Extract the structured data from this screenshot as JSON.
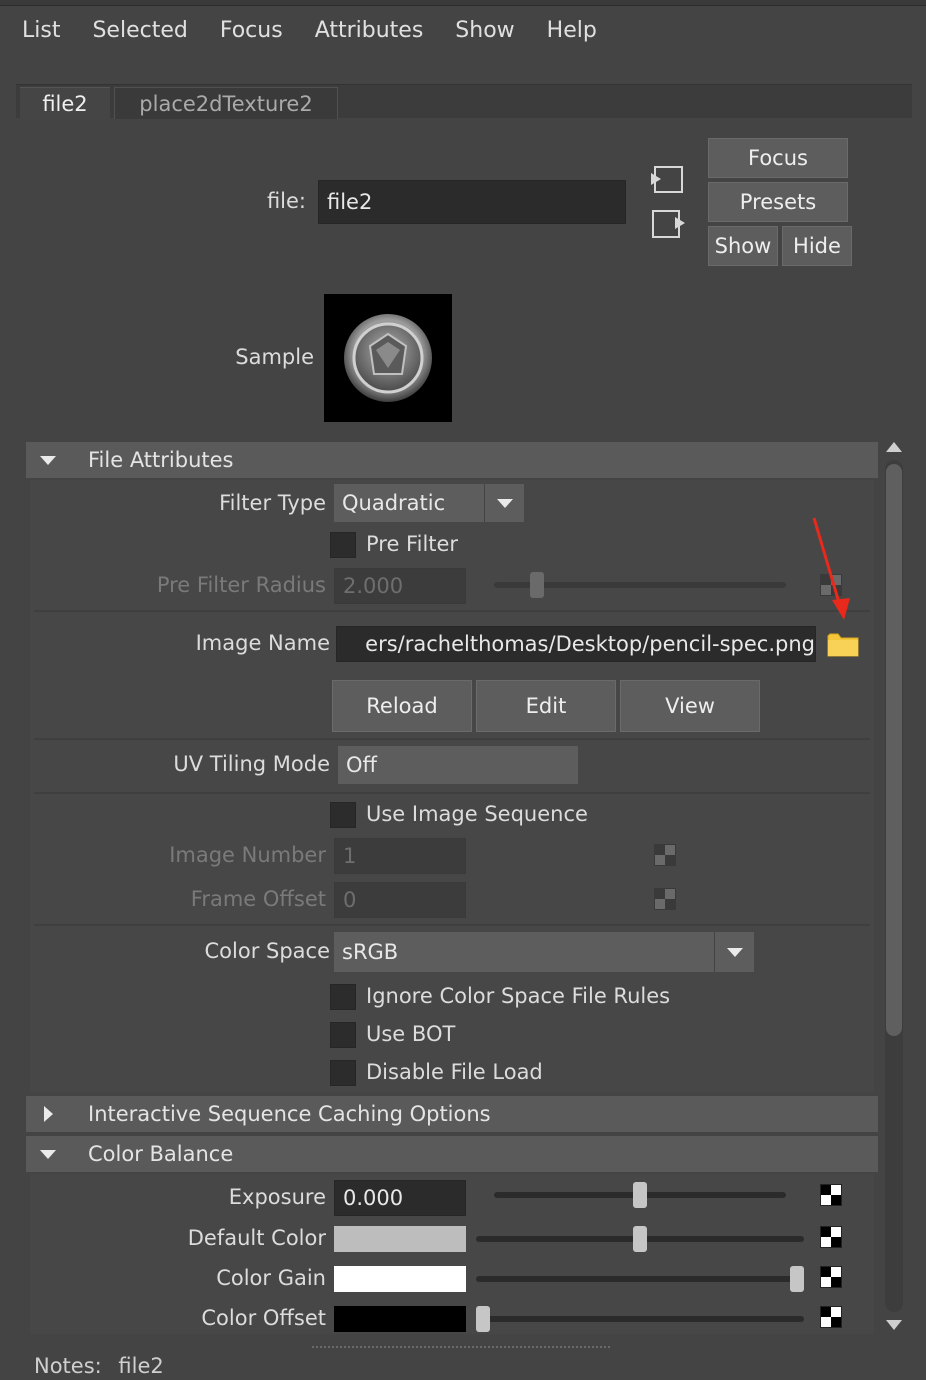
{
  "menu": [
    "List",
    "Selected",
    "Focus",
    "Attributes",
    "Show",
    "Help"
  ],
  "tabs": [
    "file2",
    "place2dTexture2"
  ],
  "node": {
    "label": "file:",
    "value": "file2"
  },
  "buttons": {
    "focus": "Focus",
    "presets": "Presets",
    "show": "Show",
    "hide": "Hide"
  },
  "sample_label": "Sample",
  "sections": {
    "file_attributes": "File Attributes",
    "interactive_caching": "Interactive Sequence Caching Options",
    "color_balance": "Color Balance"
  },
  "file_attributes": {
    "filter_type_label": "Filter Type",
    "filter_type_value": "Quadratic",
    "pre_filter_label": "Pre Filter",
    "pre_filter_radius_label": "Pre Filter Radius",
    "pre_filter_radius_value": "2.000",
    "pre_filter_radius_slider": 0.13,
    "image_name_label": "Image Name",
    "image_name_value": "ers/rachelthomas/Desktop/pencil-spec.png",
    "reload_label": "Reload",
    "edit_label": "Edit",
    "view_label": "View",
    "uv_tiling_label": "UV Tiling Mode",
    "uv_tiling_value": "Off",
    "use_image_sequence_label": "Use Image Sequence",
    "image_number_label": "Image Number",
    "image_number_value": "1",
    "frame_offset_label": "Frame Offset",
    "frame_offset_value": "0",
    "color_space_label": "Color Space",
    "color_space_value": "sRGB",
    "ignore_rules_label": "Ignore Color Space File Rules",
    "use_bot_label": "Use BOT",
    "disable_load_label": "Disable File Load"
  },
  "color_balance": {
    "exposure_label": "Exposure",
    "exposure_value": "0.000",
    "exposure_slider": 0.5,
    "default_color_label": "Default Color",
    "default_color_hex": "#bdbdbd",
    "default_color_slider": 0.5,
    "color_gain_label": "Color Gain",
    "color_gain_hex": "#ffffff",
    "color_gain_slider": 1.0,
    "color_offset_label": "Color Offset",
    "color_offset_hex": "#000000",
    "color_offset_slider": 0.0
  },
  "notes": {
    "label": "Notes:",
    "value": "file2"
  },
  "annotation": {
    "arrow_color": "#e8291c"
  }
}
